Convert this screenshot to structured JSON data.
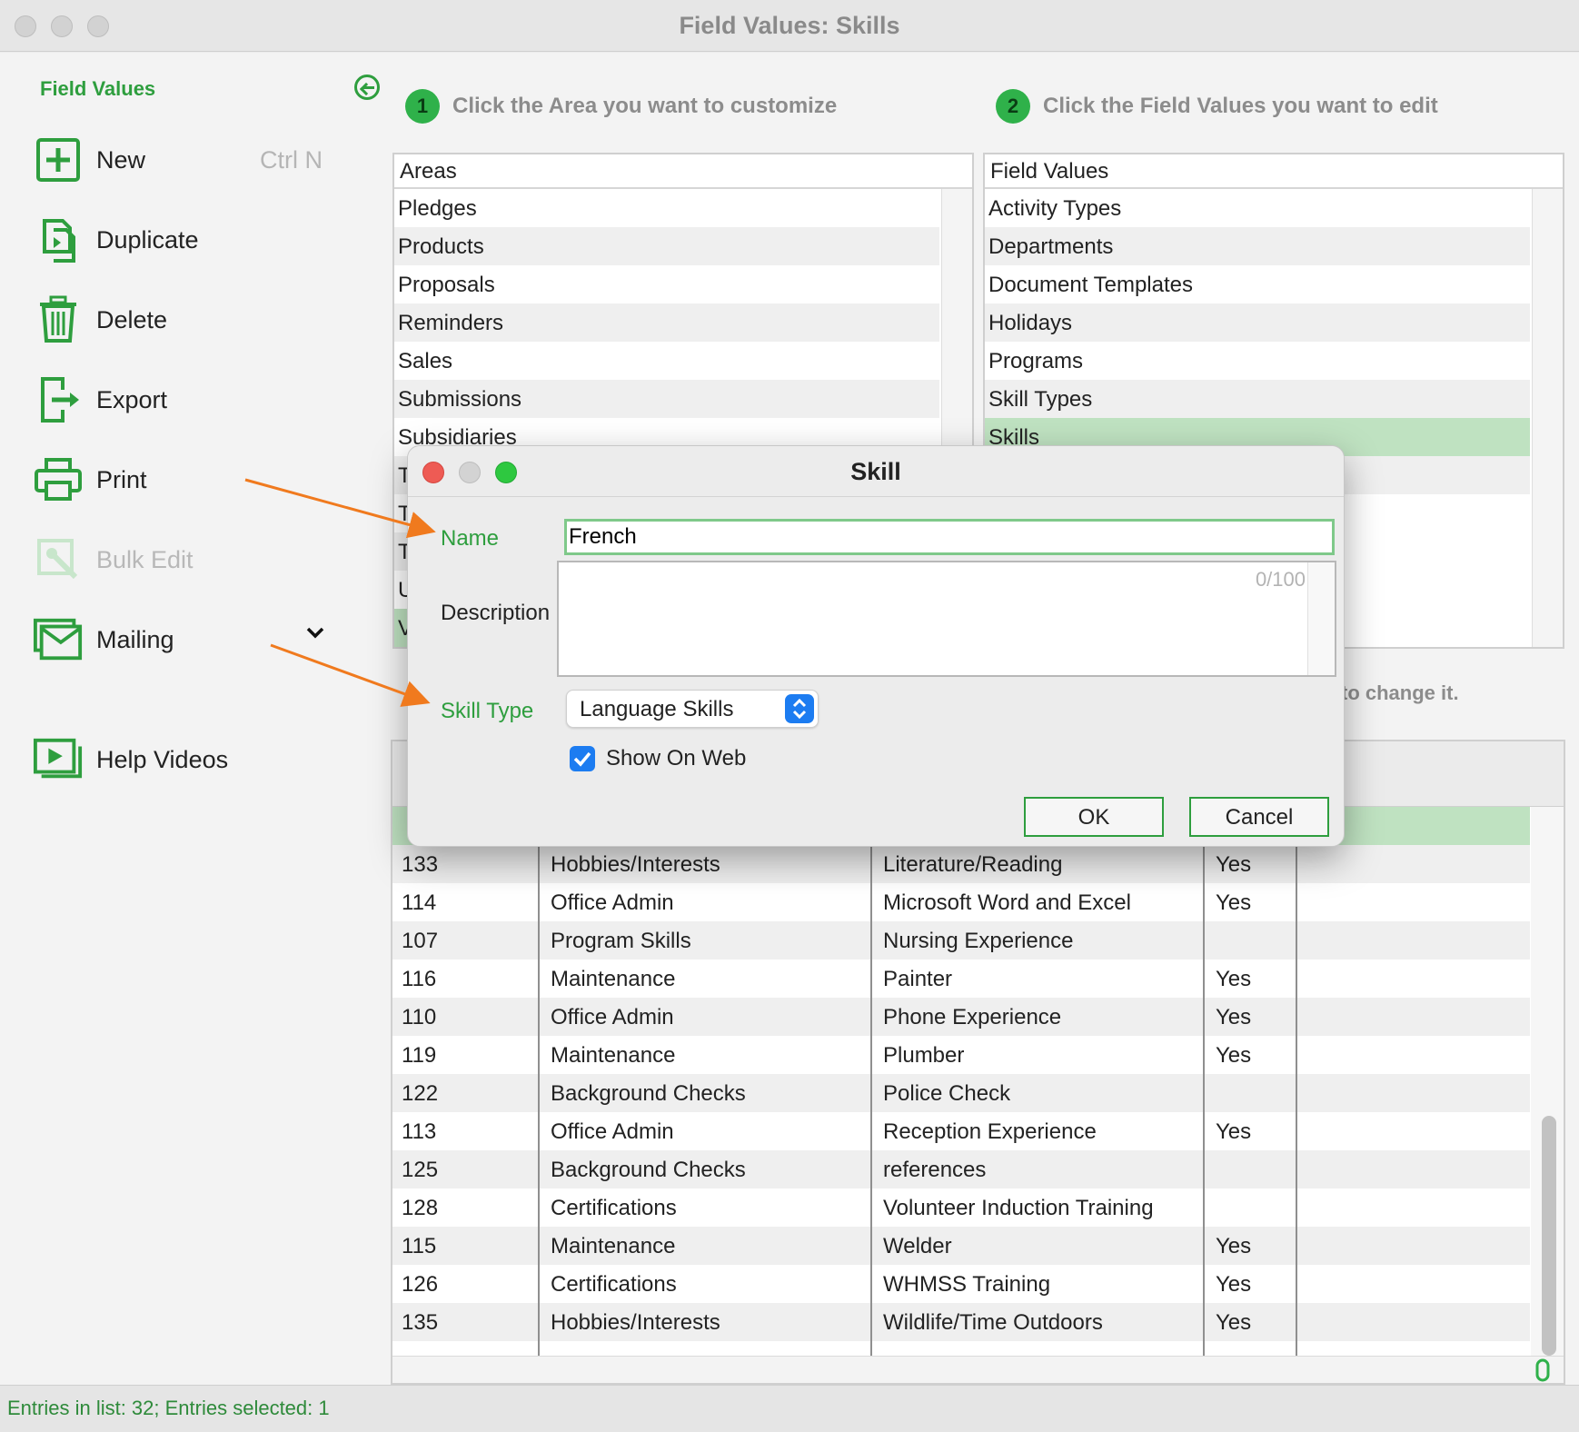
{
  "window": {
    "title": "Field Values: Skills"
  },
  "sidebar": {
    "title": "Field Values",
    "items": [
      {
        "label": "New",
        "shortcut": "Ctrl N",
        "icon": "plus-square-icon",
        "enabled": true
      },
      {
        "label": "Duplicate",
        "icon": "duplicate-icon",
        "enabled": true
      },
      {
        "label": "Delete",
        "icon": "trash-icon",
        "enabled": true
      },
      {
        "label": "Export",
        "icon": "export-icon",
        "enabled": true
      },
      {
        "label": "Print",
        "icon": "printer-icon",
        "enabled": true
      },
      {
        "label": "Bulk Edit",
        "icon": "bulk-edit-icon",
        "enabled": false
      },
      {
        "label": "Mailing",
        "icon": "envelope-icon",
        "enabled": true
      },
      {
        "label": "Help Videos",
        "icon": "video-icon",
        "enabled": true
      }
    ]
  },
  "steps": {
    "step1": {
      "number": "1",
      "text": "Click the Area you want to customize"
    },
    "step2": {
      "number": "2",
      "text": "Click the Field Values you want to edit"
    },
    "step3_partial": "to change it."
  },
  "areas": {
    "header": "Areas",
    "items": [
      "Pledges",
      "Products",
      "Proposals",
      "Reminders",
      "Sales",
      "Submissions",
      "Subsidiaries",
      "T",
      "T",
      "T",
      "U",
      "V"
    ]
  },
  "field_values": {
    "header": "Field Values",
    "items": [
      "Activity Types",
      "Departments",
      "Document Templates",
      "Holidays",
      "Programs",
      "Skill Types",
      "Skills"
    ],
    "selected": "Skills"
  },
  "skills_table": {
    "rows": [
      {
        "id": "133",
        "type": "Hobbies/Interests",
        "name": "Literature/Reading",
        "web": "Yes"
      },
      {
        "id": "114",
        "type": "Office Admin",
        "name": "Microsoft Word and Excel",
        "web": "Yes"
      },
      {
        "id": "107",
        "type": "Program Skills",
        "name": "Nursing Experience",
        "web": ""
      },
      {
        "id": "116",
        "type": "Maintenance",
        "name": "Painter",
        "web": "Yes"
      },
      {
        "id": "110",
        "type": "Office Admin",
        "name": "Phone Experience",
        "web": "Yes"
      },
      {
        "id": "119",
        "type": "Maintenance",
        "name": "Plumber",
        "web": "Yes"
      },
      {
        "id": "122",
        "type": "Background Checks",
        "name": "Police Check",
        "web": ""
      },
      {
        "id": "113",
        "type": "Office Admin",
        "name": "Reception Experience",
        "web": "Yes"
      },
      {
        "id": "125",
        "type": "Background Checks",
        "name": "references",
        "web": ""
      },
      {
        "id": "128",
        "type": "Certifications",
        "name": "Volunteer Induction Training",
        "web": ""
      },
      {
        "id": "115",
        "type": "Maintenance",
        "name": "Welder",
        "web": "Yes"
      },
      {
        "id": "126",
        "type": "Certifications",
        "name": "WHMSS Training",
        "web": "Yes"
      },
      {
        "id": "135",
        "type": "Hobbies/Interests",
        "name": "Wildlife/Time Outdoors",
        "web": "Yes"
      }
    ]
  },
  "status": {
    "text": "Entries in list: 32; Entries selected: 1"
  },
  "dialog": {
    "title": "Skill",
    "name_label": "Name",
    "name_value": "French",
    "description_label": "Description",
    "description_value": "",
    "description_counter": "0/100",
    "skill_type_label": "Skill Type",
    "skill_type_value": "Language Skills",
    "show_on_web_label": "Show On Web",
    "show_on_web_checked": true,
    "ok_label": "OK",
    "cancel_label": "Cancel"
  },
  "colors": {
    "accent_green": "#2e9e3e",
    "selection_green": "#bfe2c1",
    "annotation_arrow": "#f07a1e",
    "checkbox_blue": "#1c7cf1"
  }
}
